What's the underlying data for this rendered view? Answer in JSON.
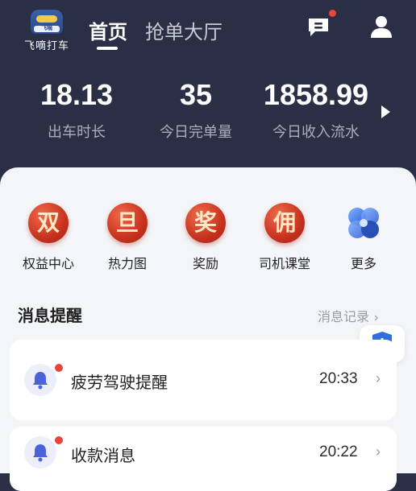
{
  "header": {
    "logo_text": "飞嘀打车",
    "logo_badge_text": "飞嘀",
    "tabs": [
      {
        "label": "首页",
        "active": true
      },
      {
        "label": "抢单大厅",
        "active": false
      }
    ],
    "stats": [
      {
        "value": "18.13",
        "label": "出车时长"
      },
      {
        "value": "35",
        "label": "今日完单量"
      },
      {
        "value": "1858.99",
        "label": "今日收入流水"
      }
    ]
  },
  "quick_actions": [
    {
      "glyph": "双",
      "label": "权益中心",
      "icon": "rights-center-icon"
    },
    {
      "glyph": "旦",
      "label": "热力图",
      "icon": "heatmap-icon"
    },
    {
      "glyph": "奖",
      "label": "奖励",
      "icon": "reward-icon"
    },
    {
      "glyph": "佣",
      "label": "司机课堂",
      "icon": "driver-class-icon"
    },
    {
      "glyph": "",
      "label": "更多",
      "icon": "more-icon"
    }
  ],
  "messages": {
    "title": "消息提醒",
    "link": "消息记录",
    "items": [
      {
        "title": "疲劳驾驶提醒",
        "time": "20:33",
        "icon": "bell-icon"
      },
      {
        "title": "收款消息",
        "time": "20:22",
        "icon": "bell-icon"
      }
    ]
  },
  "colors": {
    "header_bg": "#2b2f45",
    "accent_red": "#c8321f",
    "badge_dot": "#e8453c",
    "shield_blue": "#2f6fe0"
  }
}
